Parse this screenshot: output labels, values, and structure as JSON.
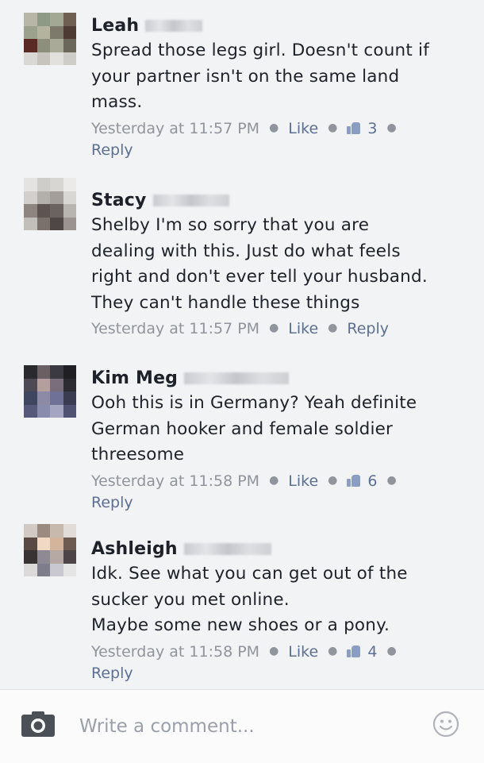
{
  "comments": [
    {
      "name": "Leah",
      "text": "Spread those legs girl. Doesn't count if\nyour partner isn't on the same land\nmass.",
      "time": "Yesterday at 11:57 PM",
      "like_label": "Like",
      "likes": "3",
      "reply_label": "Reply"
    },
    {
      "name": "Stacy",
      "text": "Shelby I'm so sorry that you are\ndealing with this. Just do what feels\nright and don't ever tell your husband.\nThey can't handle these things",
      "time": "Yesterday at 11:57 PM",
      "like_label": "Like",
      "reply_label": "Reply"
    },
    {
      "name": "Kim Meg",
      "text": "Ooh this is in Germany?  Yeah definite\nGerman hooker and female soldier\nthreesome",
      "time": "Yesterday at 11:58 PM",
      "like_label": "Like",
      "likes": "6",
      "reply_label": "Reply"
    },
    {
      "name": "Ashleigh",
      "text": "Idk. See what you can get out of the\nsucker you met online.\nMaybe some new shoes or a pony.",
      "time": "Yesterday at 11:58 PM",
      "like_label": "Like",
      "likes": "4",
      "reply_label": "Reply"
    }
  ],
  "composer": {
    "placeholder": "Write a comment...",
    "camera_icon": "camera-icon",
    "emoji_icon": "smiley-icon"
  },
  "colors": {
    "link": "#5d6f93",
    "meta": "#90949c",
    "background": "#f2f3f5"
  }
}
